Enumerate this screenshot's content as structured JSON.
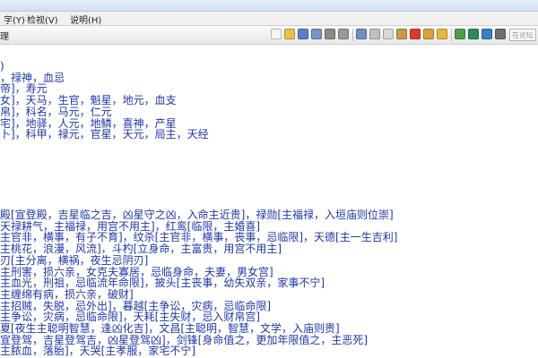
{
  "menubar": {
    "item1": "字(Y)",
    "item2": "检视(V)",
    "item3": "说明(H)"
  },
  "toolbar": {
    "left_label": "理",
    "search_placeholder": "在论坛"
  },
  "toolbar_icons": [
    {
      "name": "new-doc-icon",
      "color": "#f4f4f4"
    },
    {
      "name": "open-folder-icon",
      "color": "#e8c24a"
    },
    {
      "name": "save-icon",
      "color": "#5b7fc4"
    },
    {
      "name": "save-as-icon",
      "color": "#7b93c8"
    },
    {
      "name": "print-icon",
      "color": "#8a8a8a"
    },
    {
      "name": "print-preview-icon",
      "color": "#9a9a9a"
    },
    {
      "name": "find-icon",
      "color": "#6e8fc0"
    },
    {
      "name": "cut-icon",
      "color": "#c0c0c0"
    },
    {
      "name": "copy-icon",
      "color": "#d7d7d7"
    },
    {
      "name": "paste-icon",
      "color": "#c79a4a"
    },
    {
      "name": "delete-icon",
      "color": "#d83b2b"
    },
    {
      "name": "undo-icon",
      "color": "#d9a23a"
    },
    {
      "name": "redo-icon",
      "color": "#e7b640"
    },
    {
      "name": "link-icon",
      "color": "#4f9d4f"
    },
    {
      "name": "settings-icon",
      "color": "#2f8a5a"
    },
    {
      "name": "help-icon",
      "color": "#3a7fc9"
    },
    {
      "name": "info-icon",
      "color": "#6f6f6f"
    }
  ],
  "lines_top": [
    ")",
    "，禄神，血忌",
    "帝]，寿元",
    "女]，天马，生官，魁星，地元，血支",
    "帛]，科名，马元，仁元",
    "宅]，地驿，人元，地鳞，喜神，产星",
    "卜]，科甲，禄元，官星，天元，局主，天经"
  ],
  "lines_bottom": [
    "殿[宣登殿，吉星临之吉，凶星守之凶，入命主近贵]，禄勋[主福禄，入垣庙则位崇]",
    "天禄耕气，主福禄，用宫不用主]，红鸾[临限，主婚喜]",
    "主官非，横事，有子不育]，纹杀[主官非，横事，丧事，忌临限]，天德[主一生吉利]",
    "主桃花，浪漫，风流]，斗杓[立身命，主富贵，用宫不用主]",
    "刃[主分离，横祸，夜生忌阴刃]",
    "主刑害，损六亲，女克夫寡居，忌临身命，夫妻，男女宫]",
    "主血光，刑祖，忌临流年命限]，披头[主丧事，幼失双亲，家事不宁]",
    "主缠绵有病，损六亲，破财]",
    "主招贼，失脱，忌外出]，暮越[主争讼，灾病，忌临命限]",
    "主争讼，灾病，忌临命限]，天耗[主失财，忌入财帛宫]",
    "夏[夜生主聪明智慧，逢凶化吉]，文昌[主聪明，智慧，文学，入庙则贵]",
    "宣登驾，吉星登驾吉，凶星登驾凶]，剑锋[身命值之，更加年限值之，主恶死]",
    "主脓血，落胎]，天哭[主孝服，家宅不宁]"
  ]
}
